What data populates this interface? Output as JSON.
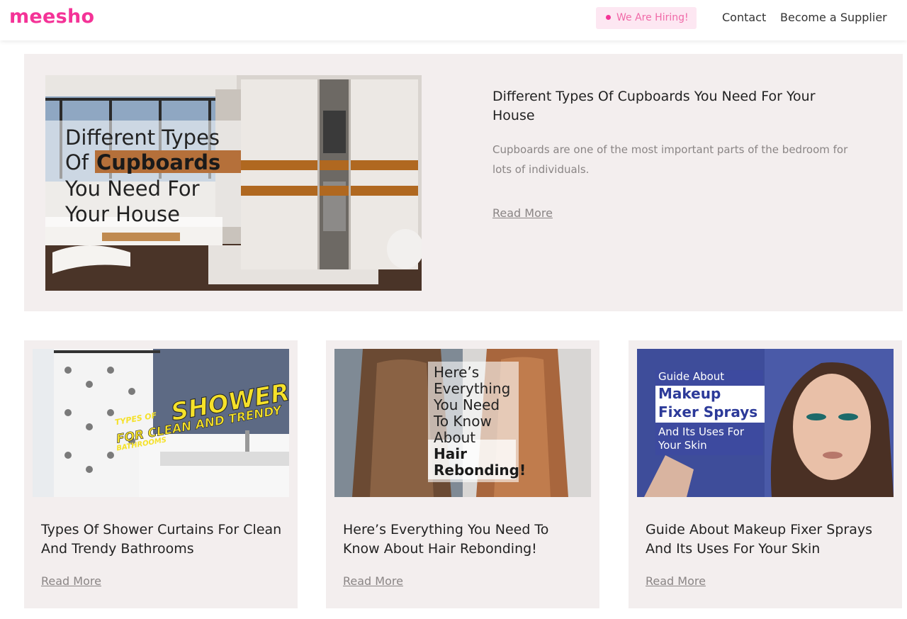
{
  "header": {
    "logo": "meesho",
    "hiring_label": "We Are Hiring!",
    "nav": {
      "contact": "Contact",
      "supplier": "Become a Supplier"
    }
  },
  "featured": {
    "title": "Different Types Of Cupboards You Need For Your House",
    "excerpt": "Cupboards are one of the most important parts of the bedroom for lots of individuals.",
    "read_more": "Read More",
    "image_text": {
      "line1": "Different Types",
      "line2a": "Of ",
      "line2b": "Cupboards",
      "line3": "You Need For",
      "line4": "Your House"
    }
  },
  "cards": [
    {
      "title": "Types Of Shower Curtains For Clean And Trendy Bathrooms",
      "read_more": "Read More",
      "image_text": {
        "big": "SHOWER CURTAINS",
        "small1": "TYPES OF",
        "small2": "FOR CLEAN AND TRENDY",
        "small3": "BATHROOMS"
      }
    },
    {
      "title": "Here’s Everything You Need To Know About Hair Rebonding!",
      "read_more": "Read More",
      "image_text": {
        "l1": "Here’s",
        "l2": "Everything",
        "l3": "You Need",
        "l4": "To Know",
        "l5": "About",
        "l6": "Hair",
        "l7": "Rebonding!"
      }
    },
    {
      "title": "Guide About Makeup Fixer Sprays And Its Uses For Your Skin",
      "read_more": "Read More",
      "image_text": {
        "l1": "Guide About",
        "l2": "Makeup",
        "l3": "Fixer Sprays",
        "l4": "And Its Uses For",
        "l5": "Your Skin"
      }
    }
  ],
  "colors": {
    "brand": "#f43397",
    "card_bg": "#f3eeee",
    "muted": "#8a8585"
  }
}
